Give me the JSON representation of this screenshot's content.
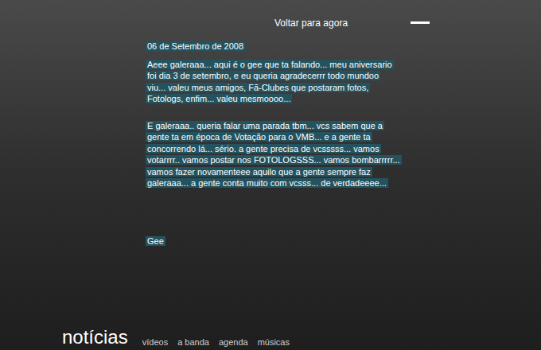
{
  "top_nav": {
    "back_link": "Voltar para agora"
  },
  "post": {
    "date": "06 de Setembro de 2008",
    "paragraphs": [
      [
        "Aeee galeraaa... aqui é o gee que ta falando... meu aniversario",
        "foi dia 3 de setembro, e eu queria agradecerrr todo mundoo",
        "viu... valeu meus amigos, Fã-Clubes que postaram fotos,",
        "Fotologs, enfim... valeu mesmoooo..."
      ],
      [
        "E galeraaa.. queria falar uma parada tbm... vcs sabem que a",
        "gente ta em época de Votação para o VMB... e a gente ta",
        "concorrendo lá... sério. a gente precisa de vcsssss... vamos",
        "votarrrr.. vamos postar nos FOTOLOGSSS... vamos bombarrrrr...",
        "vamos fazer novamenteee aquilo que a gente sempre faz",
        "galeraaa... a gente conta muito com vcsss... de verdadeeee..."
      ]
    ],
    "signature": "Gee"
  },
  "bottom_nav": [
    {
      "label": "notícias",
      "selected": true
    },
    {
      "label": "vídeos",
      "selected": false
    },
    {
      "label": "a banda",
      "selected": false
    },
    {
      "label": "agenda",
      "selected": false
    },
    {
      "label": "músicas",
      "selected": false
    }
  ]
}
